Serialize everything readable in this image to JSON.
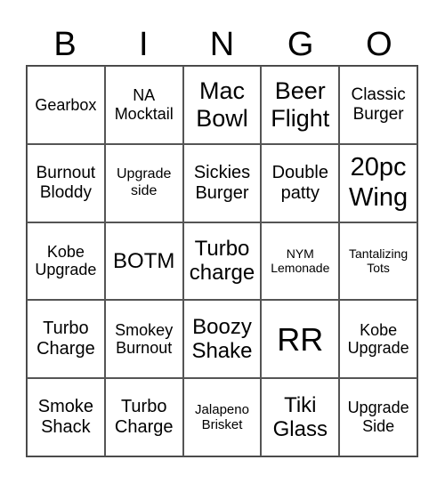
{
  "header": {
    "letters": [
      "B",
      "I",
      "N",
      "G",
      "O"
    ]
  },
  "grid": {
    "rows": [
      [
        "Gearbox",
        "NA Mocktail",
        "Mac Bowl",
        "Beer Flight",
        "Classic Burger"
      ],
      [
        "Burnout Bloddy",
        "Upgrade side",
        "Sickies Burger",
        "Double patty",
        "20pc Wing"
      ],
      [
        "Kobe Upgrade",
        "BOTM",
        "Turbo charge",
        "NYM Lemonade",
        "Tantalizing Tots"
      ],
      [
        "Turbo Charge",
        "Smokey Burnout",
        "Boozy Shake",
        "RR",
        "Kobe Upgrade"
      ],
      [
        "Smoke Shack",
        "Turbo Charge",
        "Jalapeno Brisket",
        "Tiki Glass",
        "Upgrade Side"
      ]
    ]
  },
  "colors": {
    "background": "#ffffff",
    "text": "#000000",
    "grid_line": "#555555"
  }
}
